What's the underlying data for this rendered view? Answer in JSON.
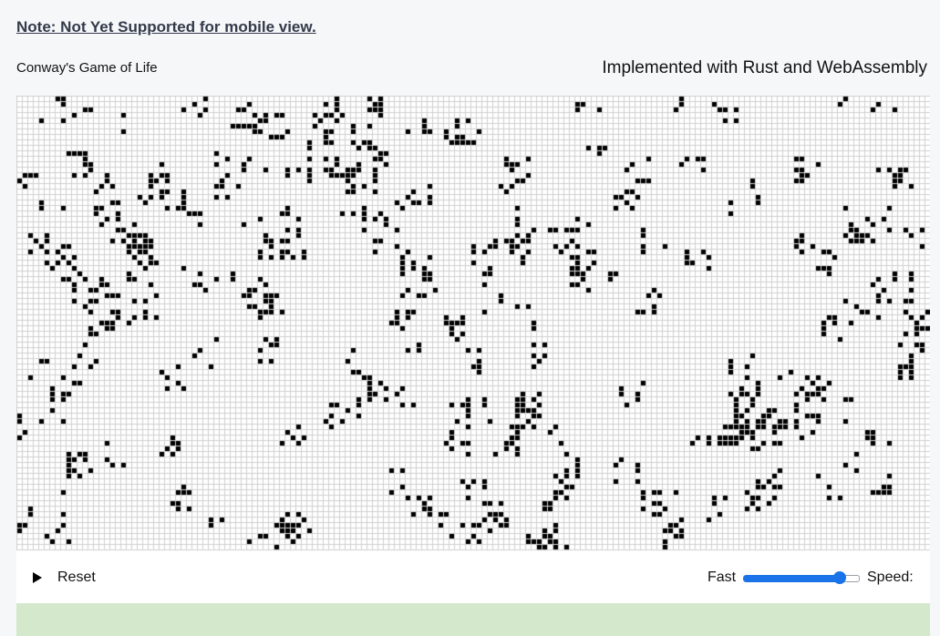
{
  "note": "Note: Not Yet Supported for mobile view.",
  "header": {
    "left_title": "Conway's Game of Life",
    "right_title": "Implemented with Rust and WebAssembly"
  },
  "controls": {
    "play_icon": "play-icon",
    "reset_label": "Reset",
    "fast_label": "Fast",
    "speed_label": "Speed:",
    "speed_value": 0.88
  },
  "colors": {
    "grid_line": "#cfcfcf",
    "live_cell": "#000000",
    "dead_cell": "#ffffff",
    "slider_accent": "#1a73e8",
    "footer_band": "#d4e8cb"
  }
}
